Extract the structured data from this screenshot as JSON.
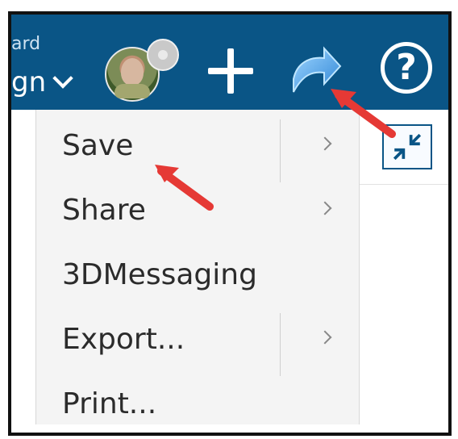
{
  "topbar": {
    "title_small": "ard",
    "title_main": "gn"
  },
  "menu": {
    "items": [
      {
        "label": "Save",
        "has_submenu": true
      },
      {
        "label": "Share",
        "has_submenu": true
      },
      {
        "label": "3DMessaging",
        "has_submenu": false
      },
      {
        "label": "Export...",
        "has_submenu": true
      },
      {
        "label": "Print...",
        "has_submenu": false
      }
    ]
  },
  "icons": {
    "user_avatar": "avatar",
    "status": "status-dot",
    "add": "plus-icon",
    "share": "share-arrow-icon",
    "help": "help-icon",
    "minimize": "minimize-icon",
    "submenu": "chevron-right-icon",
    "dropdown": "chevron-down-icon"
  },
  "colors": {
    "topbar": "#0a5586",
    "menu_bg": "#f4f4f4",
    "annotation": "#e53935"
  }
}
